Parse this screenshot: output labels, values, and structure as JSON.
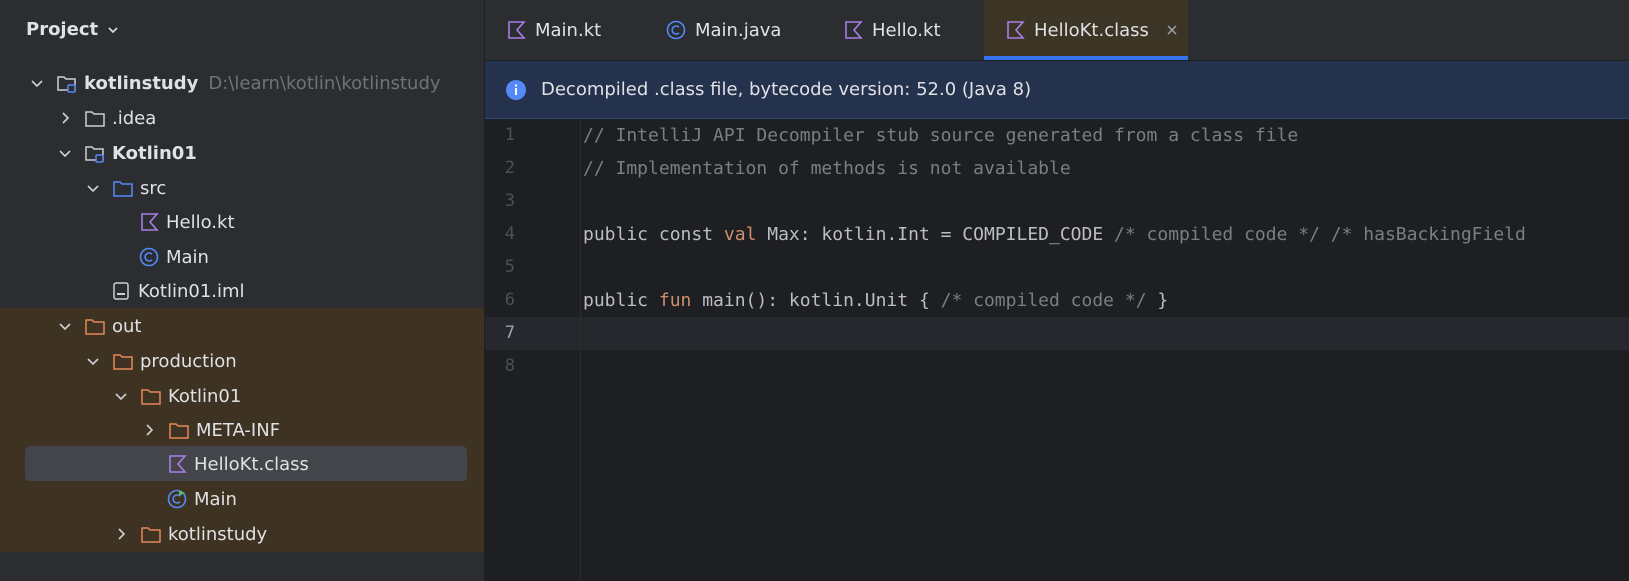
{
  "sidebar": {
    "title": "Project",
    "tree": [
      {
        "label": "kotlinstudy",
        "path": "D:\\learn\\kotlin\\kotlinstudy"
      },
      {
        "label": ".idea"
      },
      {
        "label": "Kotlin01"
      },
      {
        "label": "src"
      },
      {
        "label": "Hello.kt"
      },
      {
        "label": "Main"
      },
      {
        "label": "Kotlin01.iml"
      },
      {
        "label": "out"
      },
      {
        "label": "production"
      },
      {
        "label": "Kotlin01"
      },
      {
        "label": "META-INF"
      },
      {
        "label": "HelloKt.class"
      },
      {
        "label": "Main"
      },
      {
        "label": "kotlinstudy"
      }
    ]
  },
  "tabs": [
    {
      "label": "Main.kt",
      "icon": "kotlin-file-icon"
    },
    {
      "label": "Main.java",
      "icon": "java-class-icon"
    },
    {
      "label": "Hello.kt",
      "icon": "kotlin-file-icon"
    },
    {
      "label": "HelloKt.class",
      "icon": "kotlin-file-icon",
      "active": true
    }
  ],
  "banner": {
    "text": "Decompiled .class file, bytecode version: 52.0 (Java 8)"
  },
  "editor": {
    "line_numbers": [
      "1",
      "2",
      "3",
      "4",
      "5",
      "6",
      "7",
      "8"
    ],
    "current_line": 7,
    "lines": [
      [
        {
          "t": "// IntelliJ API Decompiler stub source generated from a class file",
          "c": "cm"
        }
      ],
      [
        {
          "t": "// Implementation of methods is not available",
          "c": "cm"
        }
      ],
      [],
      [
        {
          "t": "public const ",
          "c": ""
        },
        {
          "t": "val",
          "c": "kw"
        },
        {
          "t": " Max: kotlin.Int = COMPILED_CODE ",
          "c": ""
        },
        {
          "t": "/* compiled code */ /* hasBackingField",
          "c": "cm"
        }
      ],
      [],
      [
        {
          "t": "public ",
          "c": ""
        },
        {
          "t": "fun",
          "c": "kw"
        },
        {
          "t": " main(): kotlin.Unit { ",
          "c": ""
        },
        {
          "t": "/* compiled code */",
          "c": "cm"
        },
        {
          "t": " }",
          "c": ""
        }
      ],
      [],
      []
    ]
  },
  "colors": {
    "kotlin_icon": "#a87fe6",
    "folder_blue": "#548af7",
    "folder_orange": "#e58859",
    "out_bg": "#3e3222",
    "accent": "#3574f0"
  }
}
